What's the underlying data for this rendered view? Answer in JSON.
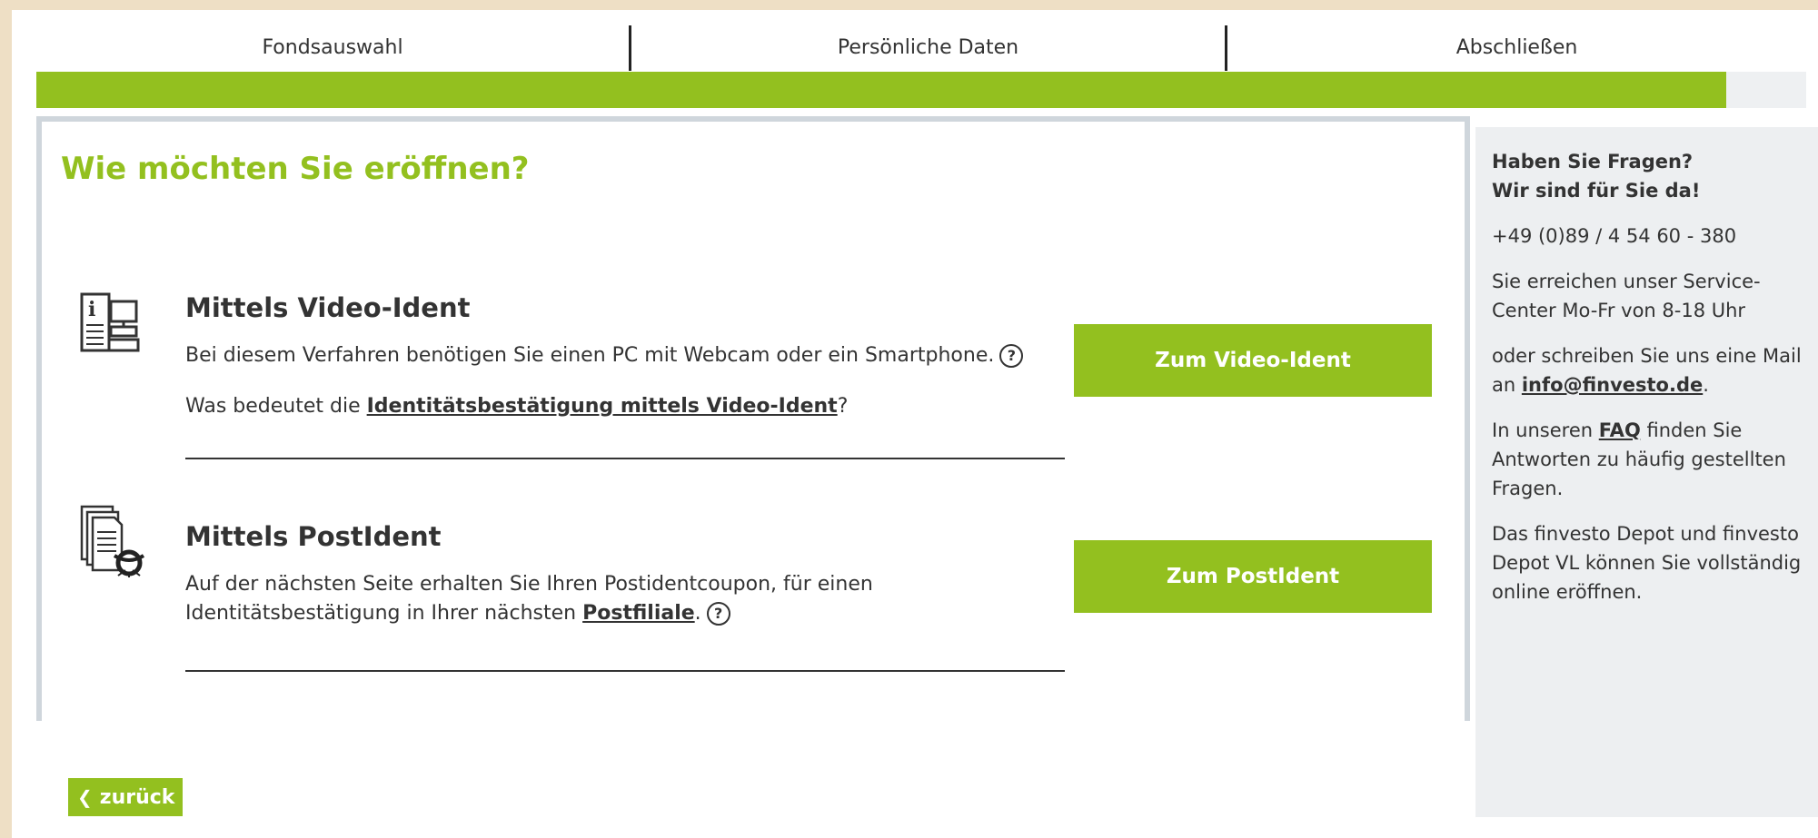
{
  "steps": {
    "step1": "Fondsauswahl",
    "step2": "Persönliche Daten",
    "step3": "Abschließen",
    "progress_fraction": 0.955
  },
  "main": {
    "title": "Wie möchten Sie eröffnen?",
    "video": {
      "title": "Mittels Video-Ident",
      "line1": "Bei diesem Verfahren benötigen Sie einen PC mit Webcam oder ein Smartphone.",
      "line2_prefix": "Was bedeutet die ",
      "line2_link": "Identitätsbestätigung mittels Video-Ident",
      "line2_suffix": "?",
      "button": "Zum Video-Ident",
      "icon": "info-computer-icon"
    },
    "post": {
      "title": "Mittels PostIdent",
      "line1": "Auf der nächsten Seite erhalten Sie Ihren Postidentcoupon, für einen",
      "line2_prefix": "Identitätsbestätigung in Ihrer nächsten ",
      "line2_link": "Postfiliale",
      "line2_suffix": ".",
      "button": "Zum PostIdent",
      "icon": "post-document-icon"
    },
    "help_glyph": "?",
    "back_label": "zurück",
    "back_icon": "chevron-left-icon"
  },
  "sidebar": {
    "heading1": "Haben Sie Fragen?",
    "heading2": "Wir sind für Sie da!",
    "phone": "+49 (0)89 / 4 54 60 - 380",
    "hours": "Sie erreichen unser Service-Center Mo-Fr von 8-18 Uhr",
    "mail_prefix": "oder schreiben Sie uns eine Mail an ",
    "mail_link": "info@finvesto.de",
    "mail_suffix": ".",
    "faq_prefix": "In unseren ",
    "faq_link": "FAQ",
    "faq_suffix": " finden Sie Antworten zu häufig gestellten Fragen.",
    "online": "Das finvesto Depot und finvesto Depot VL können Sie vollständig online eröffnen."
  },
  "colors": {
    "accent": "#93c01f",
    "background": "#eedfc5",
    "sidebar": "#edeff1"
  }
}
